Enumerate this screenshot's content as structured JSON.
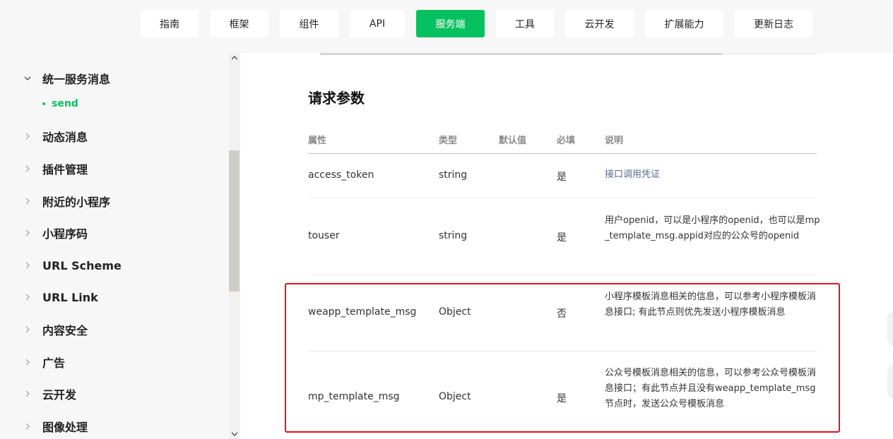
{
  "nav": {
    "items": [
      {
        "label": "指南"
      },
      {
        "label": "框架"
      },
      {
        "label": "组件"
      },
      {
        "label": "API"
      },
      {
        "label": "服务端"
      },
      {
        "label": "工具"
      },
      {
        "label": "云开发"
      },
      {
        "label": "扩展能力"
      },
      {
        "label": "更新日志"
      }
    ],
    "active": "服务端",
    "accent_color": "#07c160"
  },
  "sidebar": {
    "expanded_group": "统一服务消息",
    "sub_item": "send",
    "items": [
      {
        "label": "统一服务消息",
        "icon": "chevron-down-icon"
      },
      {
        "label": "动态消息",
        "icon": "chevron-right-icon"
      },
      {
        "label": "插件管理",
        "icon": "chevron-right-icon"
      },
      {
        "label": "附近的小程序",
        "icon": "chevron-right-icon"
      },
      {
        "label": "小程序码",
        "icon": "chevron-right-icon"
      },
      {
        "label": "URL Scheme",
        "icon": "chevron-right-icon"
      },
      {
        "label": "URL Link",
        "icon": "chevron-right-icon"
      },
      {
        "label": "内容安全",
        "icon": "chevron-right-icon"
      },
      {
        "label": "广告",
        "icon": "chevron-right-icon"
      },
      {
        "label": "云开发",
        "icon": "chevron-right-icon"
      },
      {
        "label": "图像处理",
        "icon": "chevron-right-icon"
      }
    ]
  },
  "content": {
    "section_title": "请求参数",
    "columns": [
      "属性",
      "类型",
      "默认值",
      "必填",
      "说明"
    ],
    "rows": [
      {
        "name": "access_token",
        "type": "string",
        "default": "",
        "required": "是",
        "desc": "接口调用凭证"
      },
      {
        "name": "touser",
        "type": "string",
        "default": "",
        "required": "是",
        "desc": "用户openid，可以是小程序的openid，也可以是mp_template_msg.appid对应的公众号的openid"
      },
      {
        "name": "weapp_template_msg",
        "type": "Object",
        "default": "",
        "required": "否",
        "desc": "小程序模板消息相关的信息，可以参考小程序模板消息接口; 有此节点则优先发送小程序模板消息"
      },
      {
        "name": "mp_template_msg",
        "type": "Object",
        "default": "",
        "required": "是",
        "desc": "公众号模板消息相关的信息，可以参考公众号模板消息接口；有此节点并且没有weapp_template_msg节点时，发送公众号模板消息"
      }
    ],
    "highlight_color": "#e8101d",
    "link_color": "#576b95"
  }
}
